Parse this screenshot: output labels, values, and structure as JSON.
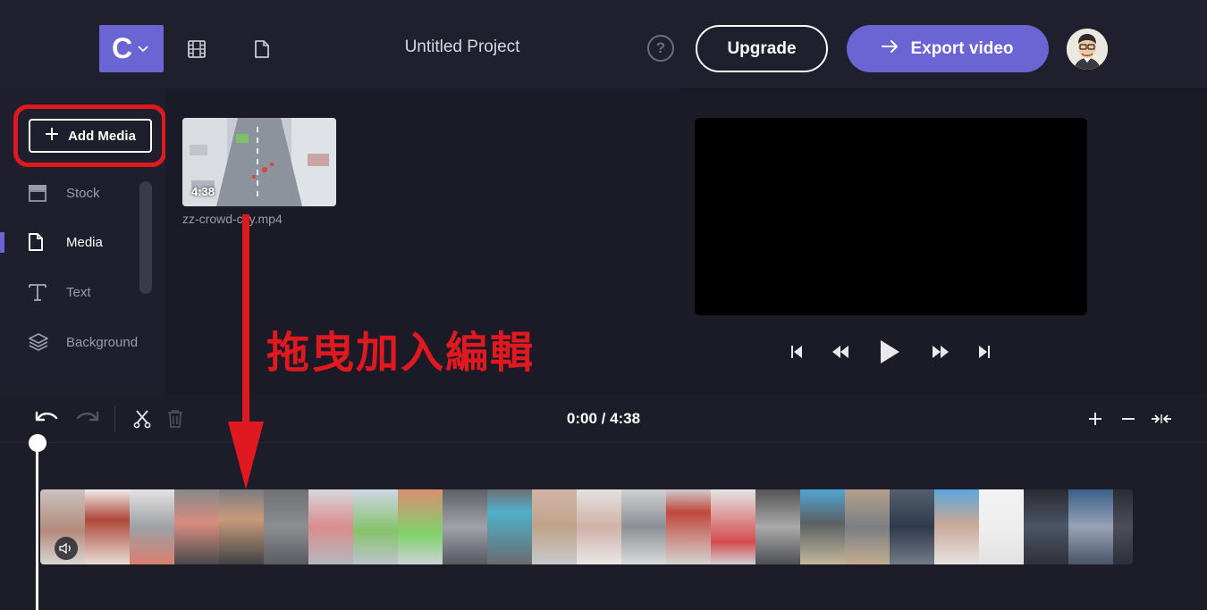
{
  "header": {
    "logo_letter": "C",
    "project_title": "Untitled Project",
    "help_label": "?",
    "upgrade_label": "Upgrade",
    "export_label": "Export video"
  },
  "sidebar": {
    "add_media_label": "Add Media",
    "items": [
      {
        "label": "Stock",
        "icon": "stock-icon"
      },
      {
        "label": "Media",
        "icon": "file-icon",
        "active": true
      },
      {
        "label": "Text",
        "icon": "text-icon"
      },
      {
        "label": "Background",
        "icon": "layers-icon"
      }
    ]
  },
  "media": {
    "clip_duration": "4:38",
    "clip_name": "zz-crowd-city.mp4"
  },
  "annotation": {
    "text": "拖曳加入編輯"
  },
  "timeline": {
    "timecode": "0:00 / 4:38"
  },
  "colors": {
    "accent": "#6b64d3",
    "annotation_red": "#e0181f",
    "background": "#1b1b27"
  }
}
